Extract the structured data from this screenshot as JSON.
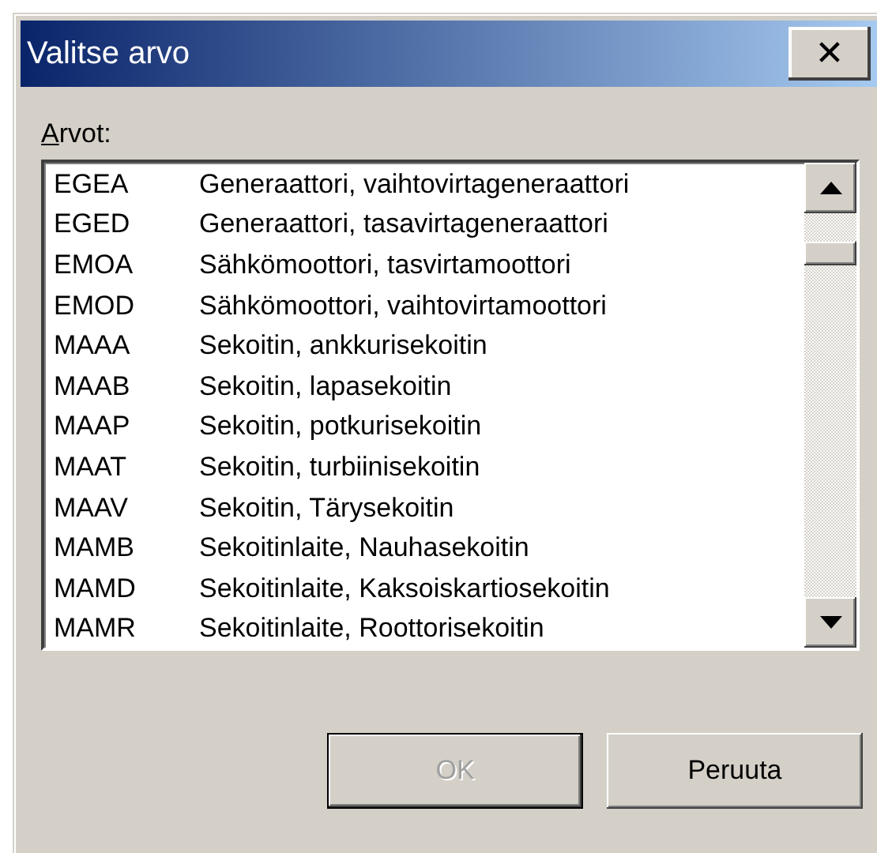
{
  "window": {
    "title": "Valitse arvo",
    "close": "✕"
  },
  "list": {
    "label": "Arvot:",
    "items": [
      {
        "code": "EGEA",
        "text": "Generaattori, vaihtovirtageneraattori"
      },
      {
        "code": "EGED",
        "text": "Generaattori, tasavirtageneraattori"
      },
      {
        "code": "EMOA",
        "text": "Sähkömoottori, tasvirtamoottori"
      },
      {
        "code": "EMOD",
        "text": "Sähkömoottori, vaihtovirtamoottori"
      },
      {
        "code": "MAAA",
        "text": "Sekoitin, ankkurisekoitin"
      },
      {
        "code": "MAAB",
        "text": "Sekoitin, lapasekoitin"
      },
      {
        "code": "MAAP",
        "text": "Sekoitin, potkurisekoitin"
      },
      {
        "code": "MAAT",
        "text": "Sekoitin, turbiinisekoitin"
      },
      {
        "code": "MAAV",
        "text": "Sekoitin, Tärysekoitin"
      },
      {
        "code": "MAMB",
        "text": "Sekoitinlaite, Nauhasekoitin"
      },
      {
        "code": "MAMD",
        "text": "Sekoitinlaite, Kaksoiskartiosekoitin"
      },
      {
        "code": "MAMR",
        "text": "Sekoitinlaite, Roottorisekoitin"
      }
    ]
  },
  "buttons": [
    {
      "label": "OK",
      "disabled": true
    },
    {
      "label": "Peruuta",
      "disabled": false
    }
  ]
}
